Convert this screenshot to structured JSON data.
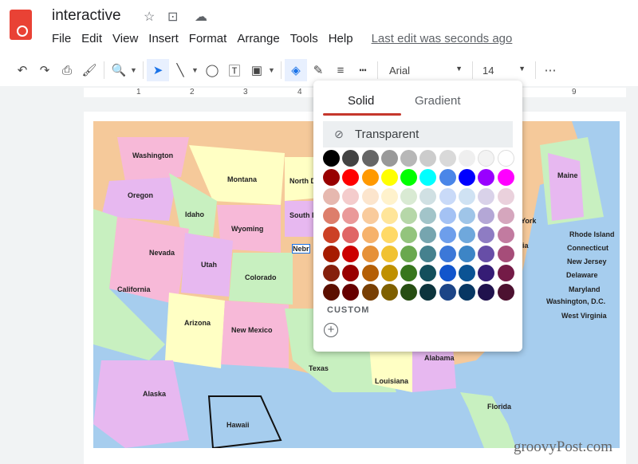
{
  "app": {
    "title": "interactive",
    "last_edit": "Last edit was seconds ago",
    "menu": [
      "File",
      "Edit",
      "View",
      "Insert",
      "Format",
      "Arrange",
      "Tools",
      "Help"
    ]
  },
  "toolbar": {
    "font": "Arial",
    "font_size": "14"
  },
  "ruler": [
    "1",
    "2",
    "3",
    "4",
    "9"
  ],
  "fill_popup": {
    "tabs": [
      "Solid",
      "Gradient"
    ],
    "active_tab": "Solid",
    "transparent_label": "Transparent",
    "custom_label": "CUSTOM",
    "colors": [
      "#000000",
      "#434343",
      "#666666",
      "#999999",
      "#b7b7b7",
      "#cccccc",
      "#d9d9d9",
      "#efefef",
      "#f3f3f3",
      "#ffffff",
      "#980000",
      "#ff0000",
      "#ff9900",
      "#ffff00",
      "#00ff00",
      "#00ffff",
      "#4a86e8",
      "#0000ff",
      "#9900ff",
      "#ff00ff",
      "#e6b8af",
      "#f4cccc",
      "#fce5cd",
      "#fff2cc",
      "#d9ead3",
      "#d0e0e3",
      "#c9daf8",
      "#cfe2f3",
      "#d9d2e9",
      "#ead1dc",
      "#dd7e6b",
      "#ea9999",
      "#f9cb9c",
      "#ffe599",
      "#b6d7a8",
      "#a2c4c9",
      "#a4c2f4",
      "#9fc5e8",
      "#b4a7d6",
      "#d5a6bd",
      "#cc4125",
      "#e06666",
      "#f6b26b",
      "#ffd966",
      "#93c47d",
      "#76a5af",
      "#6d9eeb",
      "#6fa8dc",
      "#8e7cc3",
      "#c27ba0",
      "#a61c00",
      "#cc0000",
      "#e69138",
      "#f1c232",
      "#6aa84f",
      "#45818e",
      "#3c78d8",
      "#3d85c6",
      "#674ea7",
      "#a64d79",
      "#85200c",
      "#990000",
      "#b45f06",
      "#bf9000",
      "#38761d",
      "#134f5c",
      "#1155cc",
      "#0b5394",
      "#351c75",
      "#741b47",
      "#5b0f00",
      "#660000",
      "#783f04",
      "#7f6000",
      "#274e13",
      "#0c343d",
      "#1c4587",
      "#073763",
      "#20124d",
      "#4c1130"
    ],
    "accent": "#c5372c"
  },
  "map": {
    "states": [
      "Washington",
      "Oregon",
      "Montana",
      "North D",
      "Idaho",
      "Wyoming",
      "South D",
      "Nebr",
      "Nevada",
      "Utah",
      "California",
      "Colorado",
      "Arizona",
      "New Mexico",
      "Texas",
      "Louisiana",
      "Alabama",
      "Florida",
      "Alaska",
      "Hawaii",
      "Maine",
      "York",
      "ia",
      "Rhode Island",
      "Connecticut",
      "New Jersey",
      "Delaware",
      "Maryland",
      "Washington, D.C.",
      "West Virginia"
    ]
  },
  "watermark": "groovyPost.com"
}
